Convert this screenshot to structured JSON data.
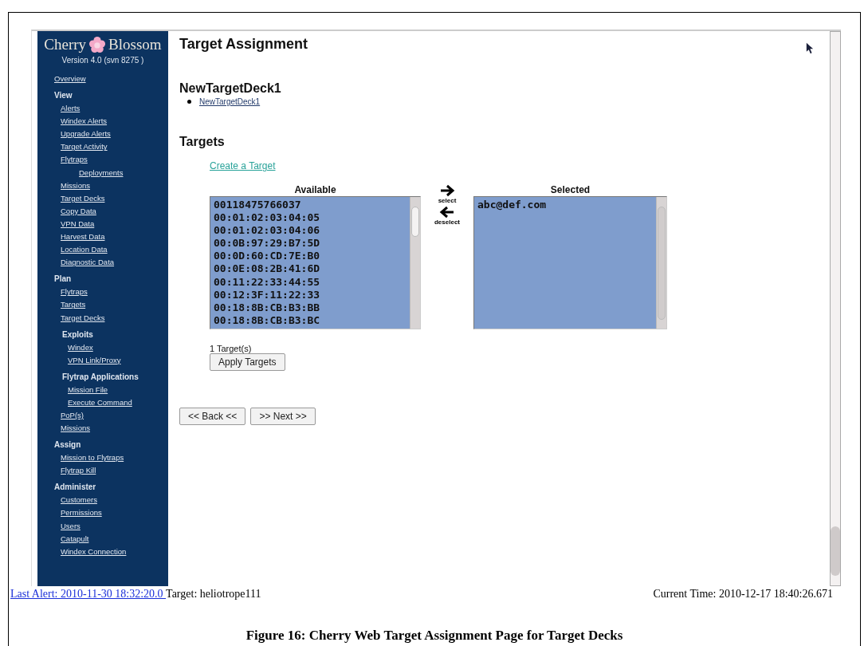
{
  "sidebar": {
    "logo": {
      "left": "Cherry",
      "right": "Blossom"
    },
    "version": "Version 4.0 (svn 8275 )",
    "items": [
      {
        "kind": "link",
        "label": "Overview"
      },
      {
        "kind": "heading",
        "label": "View",
        "children": [
          {
            "kind": "link",
            "label": "Alerts"
          },
          {
            "kind": "link",
            "label": "Windex Alerts"
          },
          {
            "kind": "link",
            "label": "Upgrade Alerts"
          },
          {
            "kind": "link",
            "label": "Target Activity"
          },
          {
            "kind": "link",
            "label": "Flytraps",
            "children": [
              {
                "kind": "link",
                "label": "Deployments"
              }
            ]
          },
          {
            "kind": "link",
            "label": "Missions"
          },
          {
            "kind": "link",
            "label": "Target Decks"
          },
          {
            "kind": "link",
            "label": "Copy Data"
          },
          {
            "kind": "link",
            "label": "VPN Data"
          },
          {
            "kind": "link",
            "label": "Harvest Data"
          },
          {
            "kind": "link",
            "label": "Location Data"
          },
          {
            "kind": "link",
            "label": "Diagnostic Data"
          }
        ]
      },
      {
        "kind": "heading",
        "label": "Plan",
        "children": [
          {
            "kind": "link",
            "label": "Flytraps"
          },
          {
            "kind": "link",
            "label": "Targets"
          },
          {
            "kind": "link",
            "label": "Target Decks"
          },
          {
            "kind": "heading",
            "label": "Exploits",
            "children": [
              {
                "kind": "link",
                "label": "Windex"
              },
              {
                "kind": "link",
                "label": "VPN Link/Proxy"
              }
            ]
          },
          {
            "kind": "heading",
            "label": "Flytrap Applications",
            "children": [
              {
                "kind": "link",
                "label": "Mission File"
              },
              {
                "kind": "link",
                "label": "Execute Command"
              }
            ]
          },
          {
            "kind": "link",
            "label": "PoP(s)"
          },
          {
            "kind": "link",
            "label": "Missions"
          }
        ]
      },
      {
        "kind": "heading",
        "label": "Assign",
        "children": [
          {
            "kind": "link",
            "label": "Mission to Flytraps"
          },
          {
            "kind": "link",
            "label": "Flytrap Kill"
          }
        ]
      },
      {
        "kind": "heading",
        "label": "Administer",
        "children": [
          {
            "kind": "link",
            "label": "Customers"
          },
          {
            "kind": "link",
            "label": "Permissions"
          },
          {
            "kind": "link",
            "label": "Users"
          },
          {
            "kind": "link",
            "label": "Catapult"
          },
          {
            "kind": "link",
            "label": "Windex Connection"
          }
        ]
      }
    ]
  },
  "main": {
    "title": "Target Assignment",
    "deck_heading": "NewTargetDeck1",
    "deck_links": [
      "NewTargetDeck1"
    ],
    "targets_heading": "Targets",
    "create_link": "Create a Target",
    "available": {
      "label": "Available",
      "items": [
        "00118475766037",
        "00:01:02:03:04:05",
        "00:01:02:03:04:06",
        "00:0B:97:29:B7:5D",
        "00:0D:60:CD:7E:B0",
        "00:0E:08:2B:41:6D",
        "00:11:22:33:44:55",
        "00:12:3F:11:22:33",
        "00:18:8B:CB:B3:BB",
        "00:18:8B:CB:B3:BC"
      ]
    },
    "select_label": "select",
    "deselect_label": "deselect",
    "selected": {
      "label": "Selected",
      "items": [
        "abc@def.com"
      ]
    },
    "count": "1 Target(s)",
    "apply_button": "Apply Targets",
    "back_button": "<< Back <<",
    "next_button": ">> Next >>"
  },
  "footer": {
    "last_alert": "Last Alert: 2010-11-30 18:32:20.0 ",
    "target": "Target: heliotrope111",
    "current_time": "Current Time: 2010-12-17 18:40:26.671"
  },
  "caption": "Figure 16: Cherry Web Target Assignment Page for Target Decks"
}
